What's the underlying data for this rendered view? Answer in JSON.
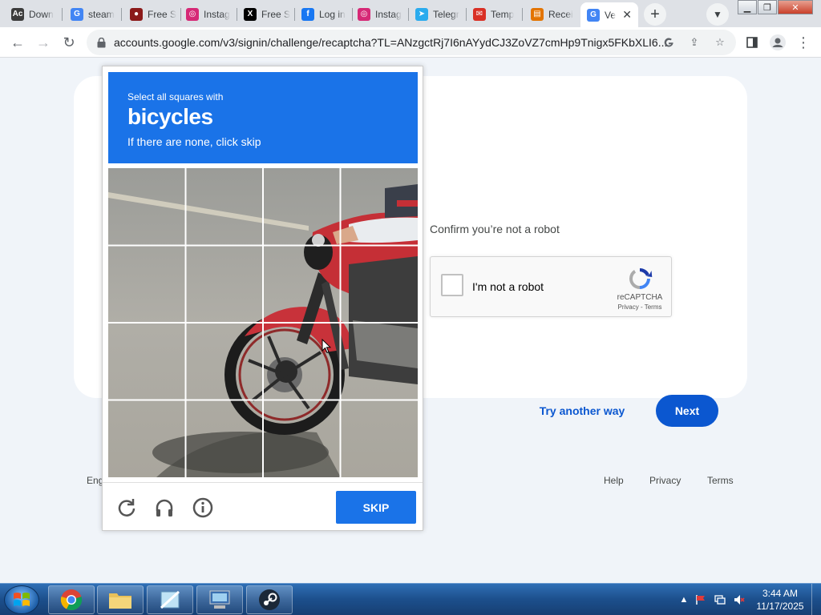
{
  "browser": {
    "tabs": [
      {
        "title": "Down",
        "icon": "adobe-icon",
        "color": "#3c3c3c",
        "glyph": "Ac"
      },
      {
        "title": "steam",
        "icon": "google-icon",
        "color": "#4285f4",
        "glyph": "G"
      },
      {
        "title": "Free S",
        "icon": "site-icon",
        "color": "#8b1a1a",
        "glyph": "●"
      },
      {
        "title": "Instag",
        "icon": "instagram-icon",
        "color": "#d62976",
        "glyph": "◎"
      },
      {
        "title": "Free S",
        "icon": "x-icon",
        "color": "#000000",
        "glyph": "X"
      },
      {
        "title": "Log in",
        "icon": "facebook-icon",
        "color": "#1877f2",
        "glyph": "f"
      },
      {
        "title": "Instag",
        "icon": "instagram-icon",
        "color": "#d62976",
        "glyph": "◎"
      },
      {
        "title": "Telegr",
        "icon": "telegram-icon",
        "color": "#2aabee",
        "glyph": "➤"
      },
      {
        "title": "Temp",
        "icon": "mail-icon",
        "color": "#d93025",
        "glyph": "✉"
      },
      {
        "title": "Recei",
        "icon": "doc-icon",
        "color": "#e37400",
        "glyph": "▤"
      },
      {
        "title": "Ve",
        "icon": "google-icon",
        "color": "#4285f4",
        "glyph": "G",
        "active": true
      }
    ],
    "url": "accounts.google.com/v3/signin/challenge/recaptcha?TL=ANzgctRj7I6nAYydCJ3ZoVZ7cmHp9Tnigx5FKbXLI6..."
  },
  "page": {
    "confirm_text": "Confirm you’re not a robot",
    "recaptcha": {
      "checkbox_label": "I'm not a robot",
      "brand": "reCAPTCHA",
      "links": "Privacy - Terms"
    },
    "try_another_way": "Try another way",
    "next": "Next",
    "footer": {
      "language": "Eng",
      "help": "Help",
      "privacy": "Privacy",
      "terms": "Terms"
    }
  },
  "challenge": {
    "line1": "Select all squares with",
    "target": "bicycles",
    "line3": "If there are none, click skip",
    "grid_rows": 4,
    "grid_cols": 4,
    "skip": "SKIP"
  },
  "taskbar": {
    "time": "3:44 AM",
    "date": "11/17/2025"
  },
  "colors": {
    "google_blue": "#0b57d0",
    "recaptcha_blue": "#1a73e8",
    "page_bg": "#f0f4f9"
  }
}
